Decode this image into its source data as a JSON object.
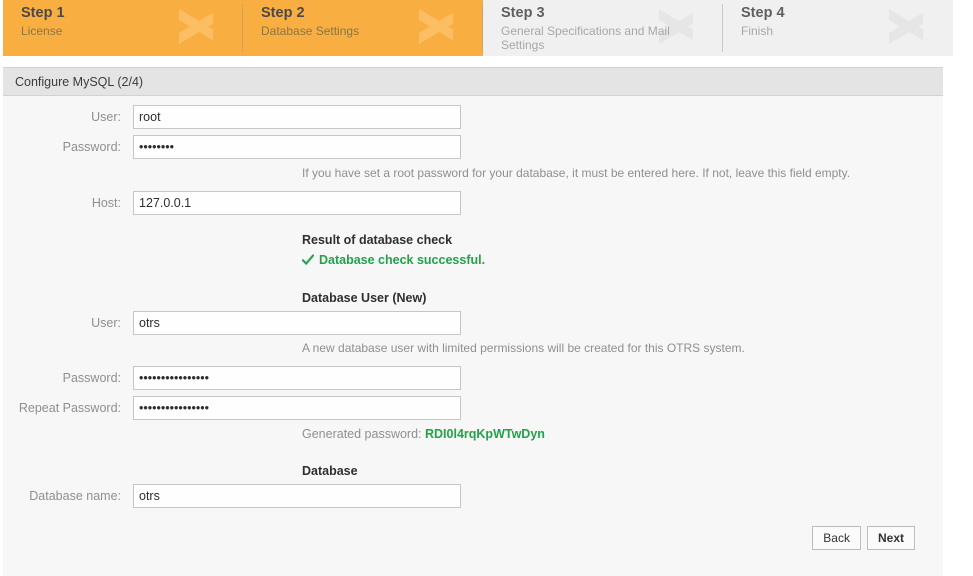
{
  "steps": [
    {
      "title": "Step 1",
      "sub": "License",
      "state": "active"
    },
    {
      "title": "Step 2",
      "sub": "Database Settings",
      "state": "active"
    },
    {
      "title": "Step 3",
      "sub": "General Specifications and Mail Settings",
      "state": "inactive"
    },
    {
      "title": "Step 4",
      "sub": "Finish",
      "state": "inactive"
    }
  ],
  "subheader": {
    "title": "Configure MySQL (2/4)"
  },
  "root_db": {
    "user_label": "User:",
    "user_value": "root",
    "password_label": "Password:",
    "password_value": "••••••••",
    "password_hint": "If you have set a root password for your database, it must be entered here. If not, leave this field empty.",
    "host_label": "Host:",
    "host_value": "127.0.0.1"
  },
  "db_check": {
    "section_title": "Result of database check",
    "status_text": "Database check successful.",
    "status_icon": "check-icon",
    "status_color": "#22a24a"
  },
  "db_user": {
    "section_title": "Database User (New)",
    "user_label": "User:",
    "user_value": "otrs",
    "user_hint": "A new database user with limited permissions will be created for this OTRS system.",
    "password_label": "Password:",
    "password_value": "••••••••••••••••",
    "repeat_password_label": "Repeat Password:",
    "repeat_password_value": "••••••••••••••••",
    "generated_label": "Generated password:",
    "generated_value": "RDI0l4rqKpWTwDyn"
  },
  "database": {
    "section_title": "Database",
    "name_label": "Database name:",
    "name_value": "otrs"
  },
  "buttons": {
    "back": "Back",
    "next": "Next"
  },
  "colors": {
    "accent_orange": "#f9ae41",
    "accent_orange_light": "#fbbe62",
    "success_green": "#22a24a",
    "panel_bg": "#f7f7f7",
    "subheader_bg": "#e4e4e4"
  }
}
